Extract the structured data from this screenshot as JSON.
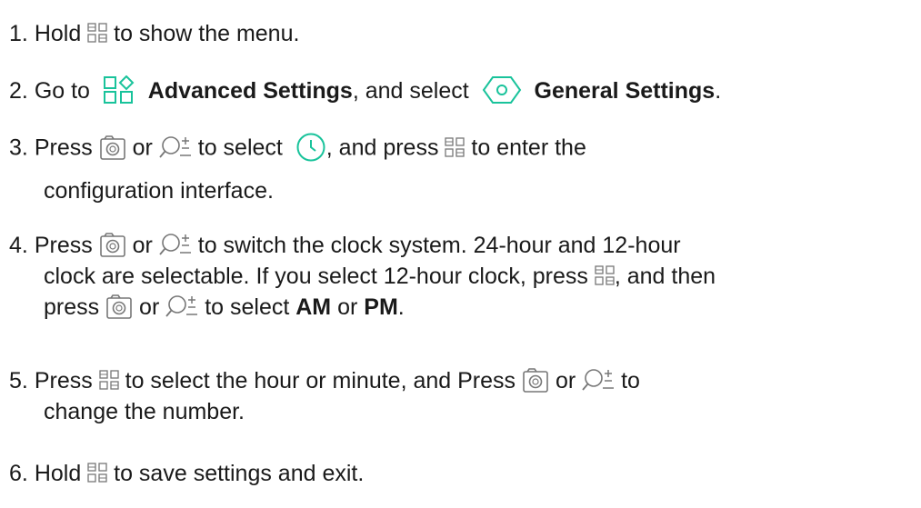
{
  "steps": [
    {
      "n": "1.",
      "t1": "Hold",
      "t2": "to show the menu."
    },
    {
      "n": "2.",
      "t1": "Go to",
      "b1": "Advanced Settings",
      "t2": ", and select",
      "b2": "General Settings",
      "t3": "."
    },
    {
      "n": "3.",
      "t1": "Press",
      "t2": "or",
      "t3": "to select",
      "t4": ", and press",
      "t5": "to enter the",
      "t6": "configuration interface."
    },
    {
      "n": "4.",
      "t1": "Press",
      "t2": "or",
      "t3": "to switch the clock system. 24-hour and 12-hour",
      "t4": "clock are selectable. If you select 12-hour clock, press",
      "t5": ", and then",
      "t6": "press",
      "t7": "or",
      "t8": "to select",
      "b1": "AM",
      "t9": "or",
      "b2": "PM",
      "t10": "."
    },
    {
      "n": "5.",
      "t1": "Press",
      "t2": "to select the hour or minute, and Press",
      "t3": "or",
      "t4": "to",
      "t5": "change the number."
    },
    {
      "n": "6.",
      "t1": "Hold",
      "t2": "to save settings and exit."
    }
  ],
  "icons": {
    "menu": "menu-grid-icon",
    "advanced": "advanced-settings-icon",
    "general": "general-settings-icon",
    "camera": "camera-icon",
    "zoom": "zoom-icon",
    "clock": "clock-icon"
  },
  "colors": {
    "text": "#1a1a1a",
    "icon": "#7a7a7a",
    "accent": "#19c39b"
  }
}
